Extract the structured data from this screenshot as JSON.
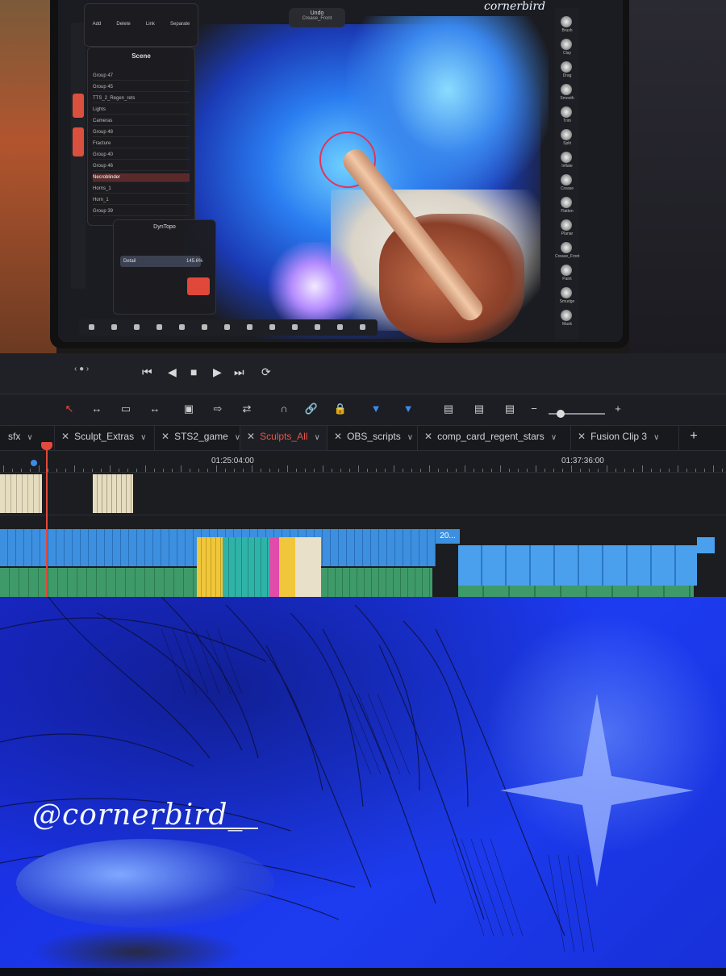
{
  "tablet": {
    "watermark": "cornerbird",
    "undo_label": "Undo",
    "undo_action": "Crease_Front",
    "scene_title": "Scene",
    "scene_rows": [
      "Group 47",
      "Group 45",
      "TTS_2_Regen_rets",
      "Lights",
      "Cameras",
      "Group 48",
      "Fracture",
      "Group 40",
      "Group 46",
      "Necroblinder",
      "Horns_1",
      "Horn_1",
      "Group 39"
    ],
    "dyntopo_title": "DynTopo",
    "dyntopo_detail_label": "Detail",
    "dyntopo_detail_value": "145.6%",
    "toolbar_top": [
      "Add",
      "Delete",
      "Link",
      "Separate"
    ],
    "right_tools": [
      "Brush",
      "Clay",
      "Drag",
      "Smooth",
      "Trim",
      "Split",
      "Inflate",
      "Crease",
      "Flatten",
      "Planar",
      "Crease_Front",
      "Paint",
      "Smudge",
      "Mask"
    ]
  },
  "transport": {
    "jog_label": "‹ ● ›",
    "buttons": [
      "⏮",
      "◀",
      "■",
      "▶",
      "⏭",
      "⟳"
    ]
  },
  "toolbar": {
    "tools": [
      "↖",
      "↔",
      "▭",
      "↔",
      "▣",
      "⇨",
      "⇄",
      "∩",
      "🔗",
      "🔒",
      "▼",
      "▼",
      "▤",
      "▤",
      "▤",
      "−",
      "+"
    ]
  },
  "tabs": [
    {
      "label": "sfx",
      "active": false
    },
    {
      "label": "Sculpt_Extras",
      "active": false
    },
    {
      "label": "STS2_game",
      "active": false
    },
    {
      "label": "Sculpts_All",
      "active": true
    },
    {
      "label": "OBS_scripts",
      "active": false
    },
    {
      "label": "comp_card_regent_stars",
      "active": false
    },
    {
      "label": "Fusion Clip 3",
      "active": false
    }
  ],
  "tab_add_label": "+",
  "ruler": {
    "timecodes": [
      "01:25:04:00",
      "01:37:36:00"
    ]
  },
  "timeline": {
    "clip_badge": "20..."
  },
  "artwork": {
    "signature": "@cornerbird_"
  },
  "colors": {
    "accent_red": "#e24a3c",
    "clip_blue": "#3d8fe0",
    "clip_green": "#3f9a6a",
    "clip_yellow": "#e8c23a",
    "clip_pink": "#e04ca8",
    "art_blue": "#1d3cf0"
  }
}
